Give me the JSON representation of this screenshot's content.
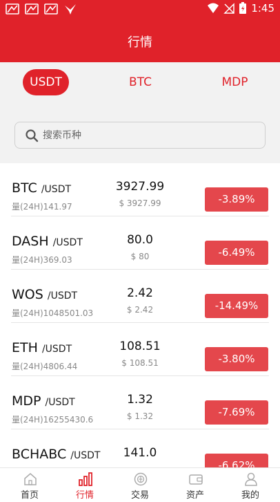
{
  "status_bar": {
    "time": "1:45"
  },
  "header": {
    "title": "行情"
  },
  "tabs": [
    {
      "label": "USDT",
      "active": true
    },
    {
      "label": "BTC",
      "active": false
    },
    {
      "label": "MDP",
      "active": false
    }
  ],
  "search": {
    "placeholder": "搜索币种"
  },
  "markets": [
    {
      "symbol": "BTC",
      "quote": "/USDT",
      "volume": "量(24H)141.97",
      "price": "3927.99",
      "price_usd": "$ 3927.99",
      "change": "-3.89%"
    },
    {
      "symbol": "DASH",
      "quote": "/USDT",
      "volume": "量(24H)369.03",
      "price": "80.0",
      "price_usd": "$ 80",
      "change": "-6.49%"
    },
    {
      "symbol": "WOS",
      "quote": "/USDT",
      "volume": "量(24H)1048501.03",
      "price": "2.42",
      "price_usd": "$ 2.42",
      "change": "-14.49%"
    },
    {
      "symbol": "ETH",
      "quote": "/USDT",
      "volume": "量(24H)4806.44",
      "price": "108.51",
      "price_usd": "$ 108.51",
      "change": "-3.80%"
    },
    {
      "symbol": "MDP",
      "quote": "/USDT",
      "volume": "量(24H)16255430.6",
      "price": "1.32",
      "price_usd": "$ 1.32",
      "change": "-7.69%"
    },
    {
      "symbol": "BCHABC",
      "quote": "/USDT",
      "volume": "",
      "price": "141.0",
      "price_usd": "",
      "change": "-6.62%"
    }
  ],
  "tabbar": [
    {
      "label": "首页",
      "icon": "home-icon",
      "active": false
    },
    {
      "label": "行情",
      "icon": "chart-bars-icon",
      "active": true
    },
    {
      "label": "交易",
      "icon": "trade-icon",
      "active": false
    },
    {
      "label": "资产",
      "icon": "wallet-icon",
      "active": false
    },
    {
      "label": "我的",
      "icon": "user-icon",
      "active": false
    }
  ],
  "colors": {
    "brand": "#e0222a",
    "change_bg": "#e4474c",
    "page_bg": "#f2f2f2"
  }
}
